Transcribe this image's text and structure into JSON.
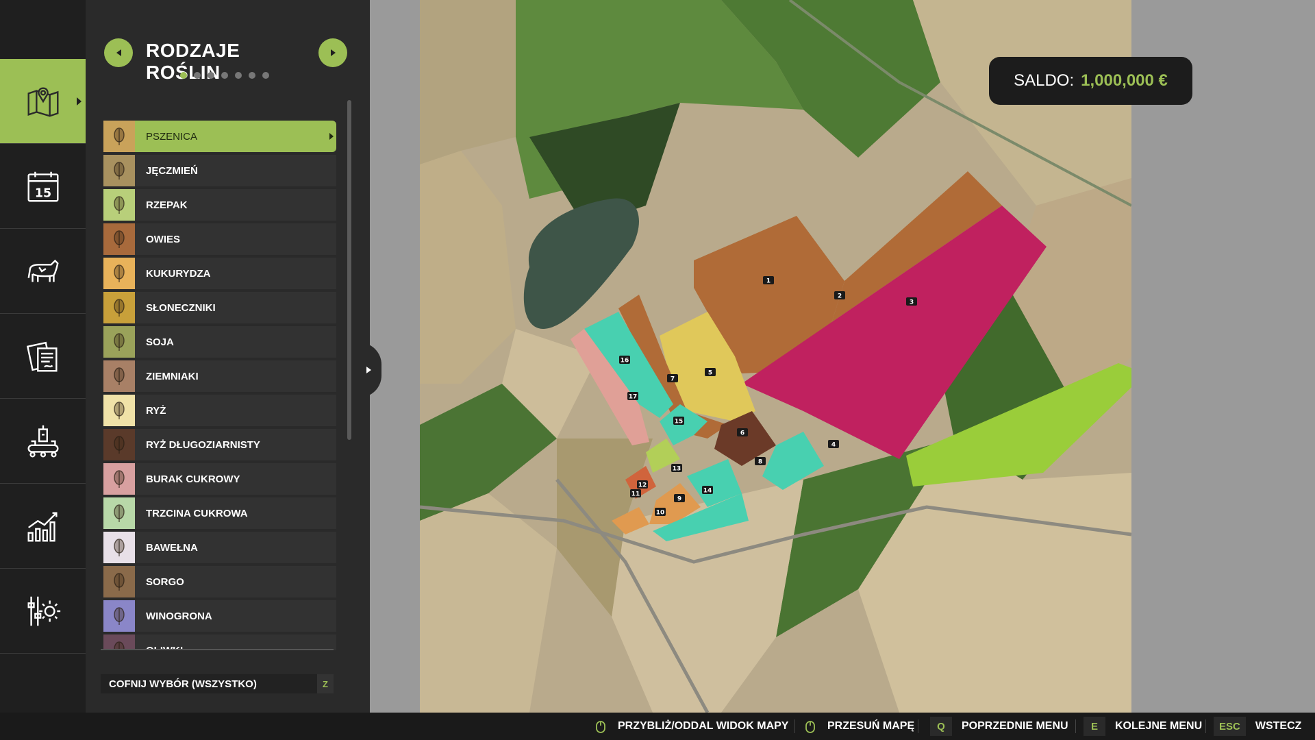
{
  "panel": {
    "title": "RODZAJE ROŚLIN",
    "page_count": 7,
    "current_page": 1,
    "crops": [
      {
        "label": "PSZENICA",
        "icon": "wheat-icon",
        "color": "#c9a25a",
        "selected": true
      },
      {
        "label": "JĘCZMIEŃ",
        "icon": "barley-icon",
        "color": "#a8915f",
        "selected": false
      },
      {
        "label": "RZEPAK",
        "icon": "canola-icon",
        "color": "#b8cf7a",
        "selected": false
      },
      {
        "label": "OWIES",
        "icon": "oat-icon",
        "color": "#a86a3c",
        "selected": false
      },
      {
        "label": "KUKURYDZA",
        "icon": "corn-icon",
        "color": "#e8b25a",
        "selected": false
      },
      {
        "label": "SŁONECZNIKI",
        "icon": "sunflower-icon",
        "color": "#c8a03a",
        "selected": false
      },
      {
        "label": "SOJA",
        "icon": "soybean-icon",
        "color": "#9aa25a",
        "selected": false
      },
      {
        "label": "ZIEMNIAKI",
        "icon": "potato-icon",
        "color": "#a88066",
        "selected": false
      },
      {
        "label": "RYŻ",
        "icon": "rice-icon",
        "color": "#f0e2a8",
        "selected": false
      },
      {
        "label": "RYŻ DŁUGOZIARNISTY",
        "icon": "long-grain-rice-icon",
        "color": "#5a3a2a",
        "selected": false
      },
      {
        "label": "BURAK CUKROWY",
        "icon": "sugar-beet-icon",
        "color": "#d8a0a0",
        "selected": false
      },
      {
        "label": "TRZCINA CUKROWA",
        "icon": "sugarcane-icon",
        "color": "#b8d8a8",
        "selected": false
      },
      {
        "label": "BAWEŁNA",
        "icon": "cotton-icon",
        "color": "#e8e0e8",
        "selected": false
      },
      {
        "label": "SORGO",
        "icon": "sorghum-icon",
        "color": "#8a6a4a",
        "selected": false
      },
      {
        "label": "WINOGRONA",
        "icon": "grapes-icon",
        "color": "#8a86c8",
        "selected": false
      },
      {
        "label": "OLIWKI",
        "icon": "olive-icon",
        "color": "#6a4a5a",
        "selected": false
      }
    ],
    "reset": {
      "label": "COFNIJ WYBÓR (WSZYSTKO)",
      "key": "Z"
    }
  },
  "rail": {
    "items": [
      {
        "name": "map",
        "icon": "map-icon",
        "active": true
      },
      {
        "name": "calendar",
        "icon": "calendar-icon",
        "active": false,
        "text": "15"
      },
      {
        "name": "animals",
        "icon": "cow-icon",
        "active": false
      },
      {
        "name": "contracts",
        "icon": "contracts-icon",
        "active": false
      },
      {
        "name": "production",
        "icon": "production-icon",
        "active": false
      },
      {
        "name": "statistics",
        "icon": "chart-icon",
        "active": false
      },
      {
        "name": "settings",
        "icon": "settings-icon",
        "active": false
      }
    ]
  },
  "saldo": {
    "label": "SALDO:",
    "value": "1,000,000 €"
  },
  "fields": {
    "labels": [
      "1",
      "2",
      "3",
      "4",
      "5",
      "6",
      "7",
      "8",
      "9",
      "10",
      "11",
      "12",
      "13",
      "14",
      "15",
      "16",
      "17"
    ]
  },
  "hints": [
    {
      "key": "",
      "icon": "mouse-icon",
      "label": "PRZYBLIŻ/ODDAL WIDOK MAPY"
    },
    {
      "key": "",
      "icon": "mouse-icon",
      "label": "PRZESUŃ MAPĘ"
    },
    {
      "key": "Q",
      "label": "POPRZEDNIE MENU"
    },
    {
      "key": "E",
      "label": "KOLEJNE MENU"
    },
    {
      "key": "ESC",
      "label": "WSTECZ"
    }
  ],
  "colors": {
    "accent": "#9cbf55",
    "panel": "#2a2a2a",
    "rail": "#1f1f1f"
  }
}
